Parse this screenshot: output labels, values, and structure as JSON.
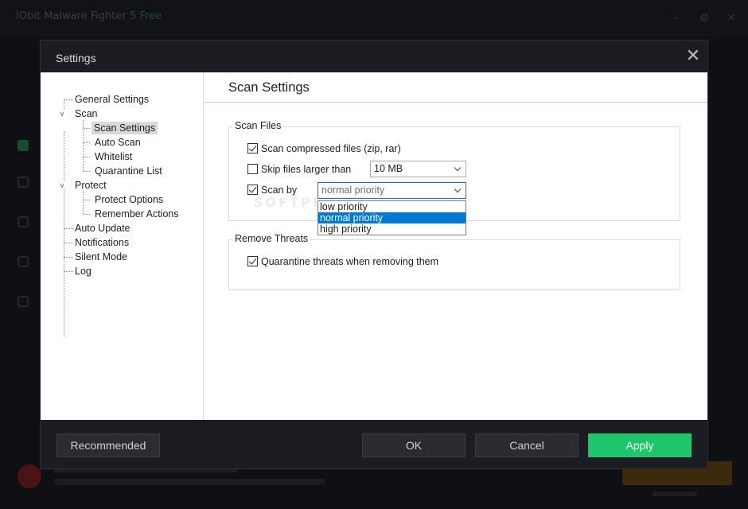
{
  "background_app": {
    "title": "IObit Malware Fighter 5",
    "title_accent": "Free"
  },
  "dialog": {
    "title": "Settings",
    "close_glyph": "✕"
  },
  "tree": {
    "items": [
      {
        "label": "General Settings"
      },
      {
        "label": "Scan"
      },
      {
        "label": "Scan Settings"
      },
      {
        "label": "Auto Scan"
      },
      {
        "label": "Whitelist"
      },
      {
        "label": "Quarantine List"
      },
      {
        "label": "Protect"
      },
      {
        "label": "Protect Options"
      },
      {
        "label": "Remember Actions"
      },
      {
        "label": "Auto Update"
      },
      {
        "label": "Notifications"
      },
      {
        "label": "Silent Mode"
      },
      {
        "label": "Log"
      }
    ],
    "selected": "Scan Settings",
    "expand_glyph": "v"
  },
  "pane": {
    "title": "Scan Settings",
    "scan_files": {
      "label": "Scan Files",
      "scan_compressed": {
        "label": "Scan compressed files (zip, rar)",
        "checked": true
      },
      "skip_larger": {
        "label": "Skip files larger than",
        "checked": false,
        "value": "10 MB"
      },
      "scan_by": {
        "label": "Scan by",
        "checked": true,
        "value": "normal priority",
        "options": [
          "low priority",
          "normal priority",
          "high priority"
        ],
        "highlighted": "normal priority"
      }
    },
    "remove_threats": {
      "label": "Remove Threats",
      "quarantine": {
        "label": "Quarantine threats when removing them",
        "checked": true
      }
    },
    "watermark": "SOFTPEDIA"
  },
  "footer": {
    "recommended": "Recommended",
    "ok": "OK",
    "cancel": "Cancel",
    "apply": "Apply"
  },
  "colors": {
    "accent_green": "#1fc56a",
    "selection_blue": "#0078d7",
    "dialog_dark": "#1b1d22"
  }
}
